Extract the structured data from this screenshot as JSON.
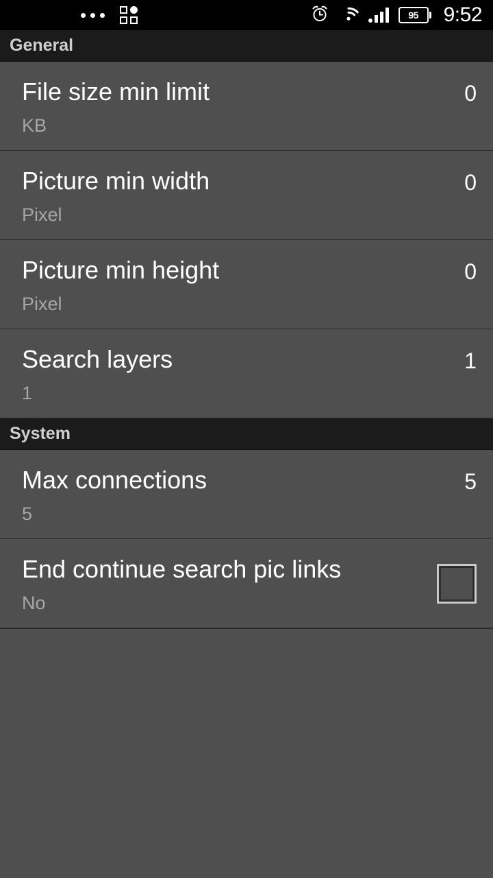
{
  "status_bar": {
    "left_icons": [
      "more-dots-icon",
      "grid-apps-icon"
    ],
    "right_icons": [
      "alarm-icon",
      "wifi-icon",
      "signal-icon"
    ],
    "battery_level": "95",
    "time": "9:52"
  },
  "sections": [
    {
      "header": "General",
      "items": [
        {
          "title": "File size min limit",
          "summary": "KB",
          "value": "0",
          "control": "value"
        },
        {
          "title": "Picture min width",
          "summary": "Pixel",
          "value": "0",
          "control": "value"
        },
        {
          "title": "Picture min height",
          "summary": "Pixel",
          "value": "0",
          "control": "value"
        },
        {
          "title": "Search layers",
          "summary": "1",
          "value": "1",
          "control": "value"
        }
      ]
    },
    {
      "header": "System",
      "items": [
        {
          "title": "Max connections",
          "summary": "5",
          "value": "5",
          "control": "value"
        },
        {
          "title": "End continue search pic links",
          "summary": "No",
          "value": "",
          "control": "checkbox",
          "checked": false
        }
      ]
    }
  ],
  "colors": {
    "background": "#4f4f4f",
    "header_background": "#1b1b1b",
    "header_text": "#cfcfcf",
    "title_text": "#ffffff",
    "summary_text": "#a6a6a6",
    "divider": "#2b2b2b",
    "status_bar": "#000000"
  }
}
